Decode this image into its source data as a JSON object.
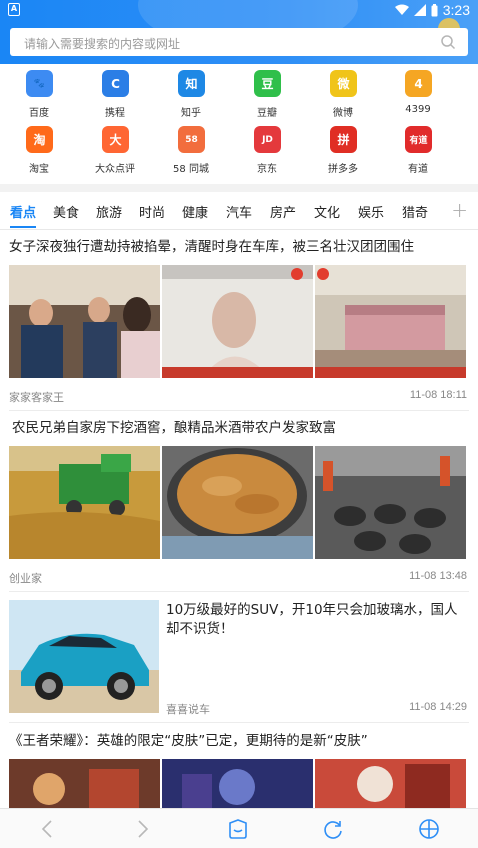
{
  "status_bar": {
    "time": "3:23"
  },
  "search": {
    "placeholder": "请输入需要搜索的内容或网址"
  },
  "quick_links": [
    {
      "label": "百度",
      "icon": "baidu-paw-icon",
      "color": "#3d8bf2",
      "glyph": "🐾"
    },
    {
      "label": "携程",
      "icon": "ctrip-icon",
      "color": "#2b7ee6",
      "glyph": "C"
    },
    {
      "label": "知乎",
      "icon": "zhihu-icon",
      "color": "#1e88e5",
      "glyph": "知"
    },
    {
      "label": "豆瓣",
      "icon": "douban-icon",
      "color": "#2fbf4a",
      "glyph": "豆"
    },
    {
      "label": "微博",
      "icon": "weibo-icon",
      "color": "#f0c419",
      "glyph": "微"
    },
    {
      "label": "4399",
      "icon": "4399-icon",
      "color": "#f5a623",
      "glyph": "4"
    },
    {
      "label": "淘宝",
      "icon": "taobao-icon",
      "color": "#ff6a1a",
      "glyph": "淘"
    },
    {
      "label": "大众点评",
      "icon": "dianping-icon",
      "color": "#ff6633",
      "glyph": "大"
    },
    {
      "label": "58 同城",
      "icon": "58-icon",
      "color": "#f26d3d",
      "glyph": "58"
    },
    {
      "label": "京东",
      "icon": "jd-icon",
      "color": "#e4393c",
      "glyph": "JD"
    },
    {
      "label": "拼多多",
      "icon": "pinduoduo-icon",
      "color": "#e02e24",
      "glyph": "拼"
    },
    {
      "label": "有道",
      "icon": "youdao-icon",
      "color": "#e12b2b",
      "glyph": "有道"
    }
  ],
  "tabs": [
    "看点",
    "美食",
    "旅游",
    "时尚",
    "健康",
    "汽车",
    "房产",
    "文化",
    "娱乐",
    "猎奇"
  ],
  "articles": [
    {
      "title": "女子深夜独行遭劫持被掐晕，清醒时身在车库，被三名壮汉团团围住",
      "source": "家家客家王",
      "time": "11-08 18:11"
    },
    {
      "title": "农民兄弟自家房下挖酒窖，酿精品米酒带农户发家致富",
      "source": "创业家",
      "time": "11-08 13:48"
    },
    {
      "title": "10万级最好的SUV，开10年只会加玻璃水，国人却不识货！",
      "source": "喜喜说车",
      "time": "11-08 14:29"
    },
    {
      "title": "《王者荣耀》：英雄的限定“皮肤”已定，更期待的是新“皮肤”",
      "source": "",
      "time": ""
    }
  ],
  "colors": {
    "accent": "#1a86f5",
    "header": "#1a86f5"
  }
}
